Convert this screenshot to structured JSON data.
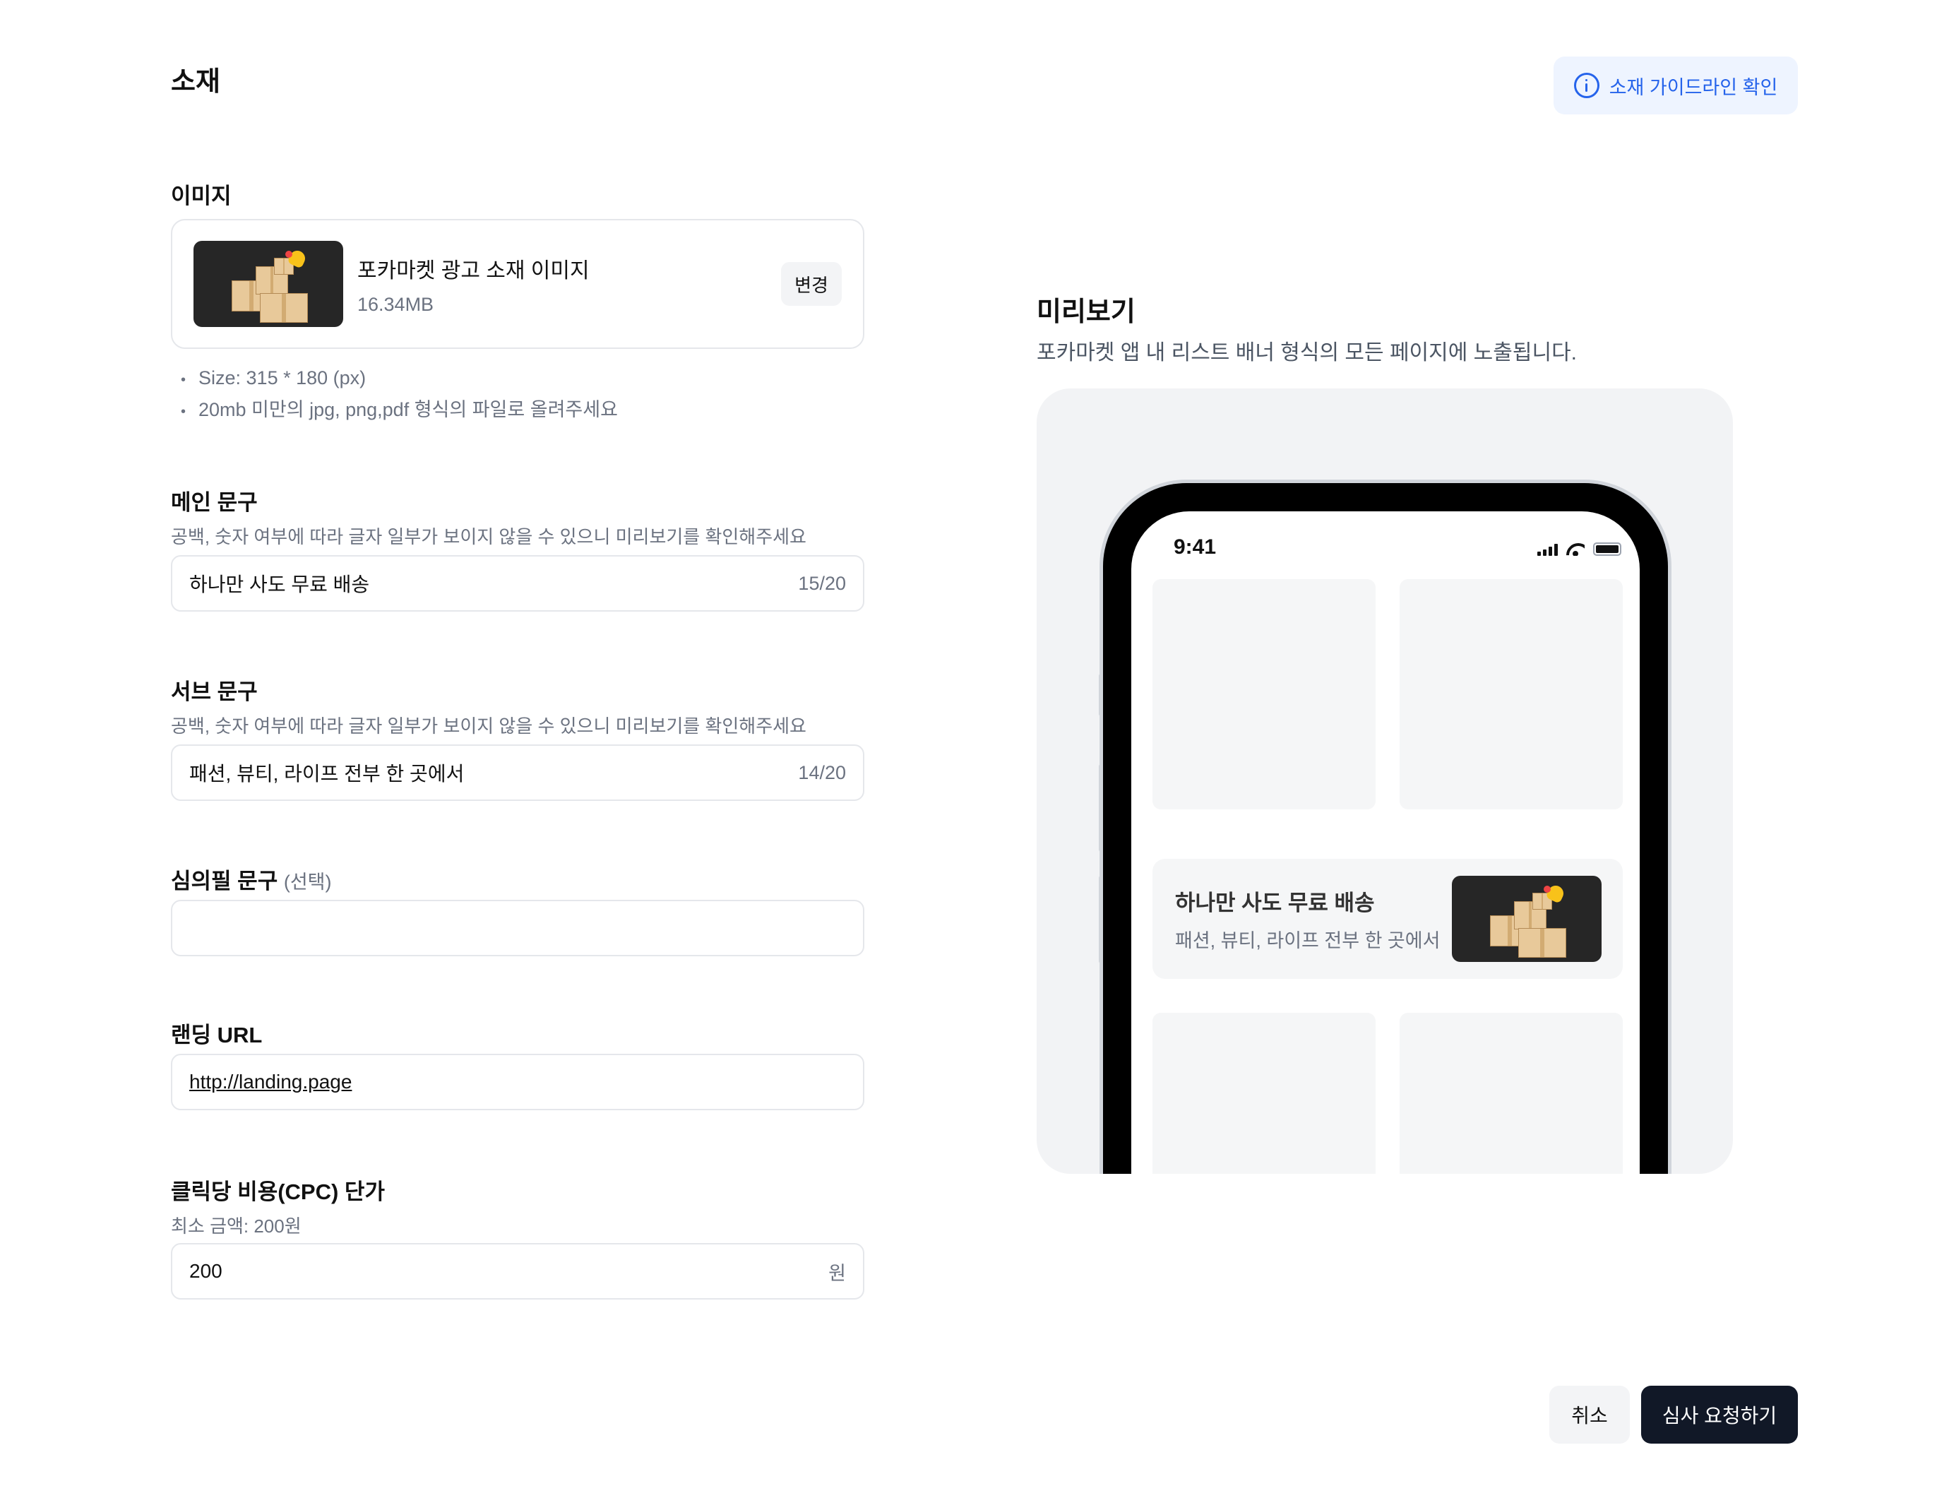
{
  "header": {
    "title": "소재",
    "guide_button_label": "소재 가이드라인 확인",
    "guide_icon": "info-icon"
  },
  "image_field": {
    "label": "이미지",
    "file_name": "포카마켓 광고 소재 이미지",
    "file_size": "16.34MB",
    "change_label": "변경",
    "guides": [
      "Size: 315 * 180 (px)",
      "20mb 미만의 jpg, png,pdf 형식의 파일로 올려주세요"
    ]
  },
  "main_copy": {
    "label": "메인 문구",
    "description": "공백, 숫자 여부에 따라 글자 일부가 보이지 않을 수 있으니 미리보기를 확인해주세요",
    "value": "하나만 사도 무료 배송",
    "counter": "15/20"
  },
  "sub_copy": {
    "label": "서브 문구",
    "description": "공백, 숫자 여부에 따라 글자 일부가 보이지 않을 수 있으니 미리보기를 확인해주세요",
    "value": "패션, 뷰티, 라이프 전부 한 곳에서",
    "counter": "14/20"
  },
  "review_copy": {
    "label": "심의필 문구",
    "optional_label": "(선택)",
    "value": ""
  },
  "landing_url": {
    "label": "랜딩 URL",
    "value": "http://landing.page"
  },
  "cpc": {
    "label": "클릭당 비용(CPC) 단가",
    "description": "최소 금액: 200원",
    "value": "200",
    "unit": "원"
  },
  "preview": {
    "title": "미리보기",
    "description": "포카마켓 앱 내 리스트 배너 형식의 모든 페이지에 노출됩니다.",
    "status_time": "9:41",
    "banner_main": "하나만 사도 무료 배송",
    "banner_sub": "패션, 뷰티, 라이프 전부 한 곳에서"
  },
  "footer": {
    "cancel_label": "취소",
    "submit_label": "심사 요청하기"
  },
  "colors": {
    "accent": "#2563eb",
    "accent_bg": "#eef4ff",
    "primary_button": "#111827",
    "border": "#e5e7eb",
    "muted_text": "#6b7280",
    "preview_bg": "#f2f3f5"
  }
}
